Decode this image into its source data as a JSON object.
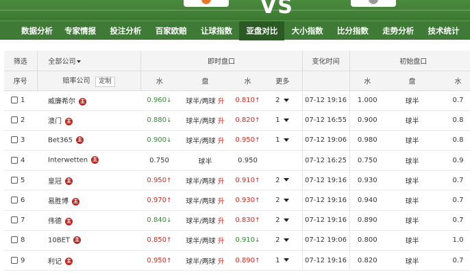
{
  "banner": {
    "vs": "VS"
  },
  "nav": [
    {
      "label": "数据分析"
    },
    {
      "label": "专家情报"
    },
    {
      "label": "投注分析"
    },
    {
      "label": "百家欧赔"
    },
    {
      "label": "让球指数"
    },
    {
      "label": "亚盘对比",
      "active": true
    },
    {
      "label": "大小指数"
    },
    {
      "label": "比分指数"
    },
    {
      "label": "走势分析"
    },
    {
      "label": "技术统计"
    }
  ],
  "header1": {
    "filter": "筛选",
    "company_select": "全部公司",
    "live": "即时盘口",
    "change_time": "变化时间",
    "initial": "初始盘口"
  },
  "header2": {
    "index": "序号",
    "company": "赔率公司",
    "custom": "定制",
    "water1": "水",
    "handicap": "盘",
    "water2": "水",
    "more": "更多",
    "init_water1": "水",
    "init_handicap": "盘",
    "init_water2": "水"
  },
  "zhu_label": "主",
  "colors": {
    "up": "#d2281e",
    "down": "#2e8b2e",
    "nav_bg": "#3f7a36",
    "nav_active": "#2b5a24"
  },
  "rows": [
    {
      "idx": "1",
      "company": "威廉希尔",
      "w1": "0.960",
      "w1_arrow": "↓",
      "w1_dir": "down",
      "hc": "球半/两球",
      "hc_mark": "升",
      "w2": "0.810",
      "w2_arrow": "↑",
      "w2_dir": "up",
      "more": "2",
      "time": "07-12 19:16",
      "iw1": "1.000",
      "ihc": "球半",
      "iw2": "0.7"
    },
    {
      "idx": "2",
      "company": "澳门",
      "w1": "0.880",
      "w1_arrow": "↓",
      "w1_dir": "down",
      "hc": "球半/两球",
      "hc_mark": "升",
      "w2": "0.820",
      "w2_arrow": "↑",
      "w2_dir": "up",
      "more": "1",
      "time": "07-12 16:55",
      "iw1": "0.900",
      "ihc": "球半",
      "iw2": "0.8"
    },
    {
      "idx": "3",
      "company": "Bet365",
      "w1": "0.900",
      "w1_arrow": "↓",
      "w1_dir": "down",
      "hc": "球半/两球",
      "hc_mark": "升",
      "w2": "0.950",
      "w2_arrow": "↑",
      "w2_dir": "up",
      "more": "1",
      "time": "07-12 19:06",
      "iw1": "0.980",
      "ihc": "球半",
      "iw2": "0.8"
    },
    {
      "idx": "4",
      "company": "Interwetten",
      "w1": "0.750",
      "w1_arrow": "",
      "w1_dir": "",
      "hc": "球半",
      "hc_mark": "",
      "w2": "0.950",
      "w2_arrow": "",
      "w2_dir": "",
      "more": "",
      "time": "07-12 16:25",
      "iw1": "0.750",
      "ihc": "球半",
      "iw2": "0.9"
    },
    {
      "idx": "5",
      "company": "皇冠",
      "w1": "0.950",
      "w1_arrow": "↑",
      "w1_dir": "up",
      "hc": "球半/两球",
      "hc_mark": "升",
      "w2": "0.910",
      "w2_arrow": "↑",
      "w2_dir": "up",
      "more": "2",
      "time": "07-12 19:16",
      "iw1": "0.930",
      "ihc": "球半",
      "iw2": "0.7"
    },
    {
      "idx": "6",
      "company": "易胜博",
      "w1": "0.970",
      "w1_arrow": "↑",
      "w1_dir": "up",
      "hc": "球半/两球",
      "hc_mark": "升",
      "w2": "0.930",
      "w2_arrow": "↑",
      "w2_dir": "up",
      "more": "2",
      "time": "07-12 19:16",
      "iw1": "0.940",
      "ihc": "球半",
      "iw2": "0.7"
    },
    {
      "idx": "7",
      "company": "伟德",
      "w1": "0.840",
      "w1_arrow": "↓",
      "w1_dir": "down",
      "hc": "球半/两球",
      "hc_mark": "升",
      "w2": "0.830",
      "w2_arrow": "↑",
      "w2_dir": "up",
      "more": "2",
      "time": "07-12 19:16",
      "iw1": "0.890",
      "ihc": "球半",
      "iw2": "0.7"
    },
    {
      "idx": "8",
      "company": "10BET",
      "w1": "0.850",
      "w1_arrow": "↑",
      "w1_dir": "up",
      "hc": "球半/两球",
      "hc_mark": "升",
      "w2": "0.910",
      "w2_arrow": "↓",
      "w2_dir": "down",
      "more": "2",
      "time": "07-12 19:06",
      "iw1": "0.800",
      "ihc": "球半",
      "iw2": "1.0"
    },
    {
      "idx": "9",
      "company": "利记",
      "w1": "0.950",
      "w1_arrow": "↑",
      "w1_dir": "up",
      "hc": "球半/两球",
      "hc_mark": "升",
      "w2": "0.890",
      "w2_arrow": "↑",
      "w2_dir": "up",
      "more": "1",
      "time": "07-12 19:16",
      "iw1": "0.820",
      "ihc": "球半",
      "iw2": "0.7"
    }
  ]
}
